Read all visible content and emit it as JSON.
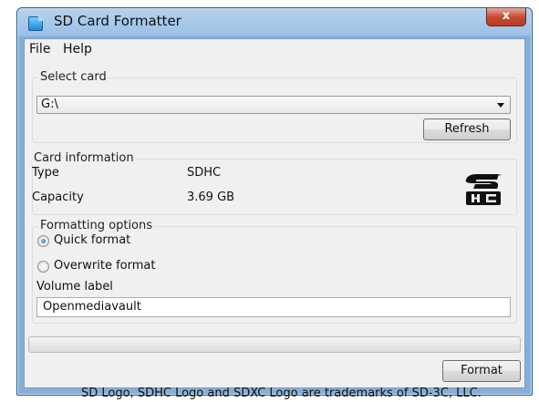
{
  "window": {
    "title": "SD Card Formatter",
    "close_glyph": "x"
  },
  "menu": {
    "file": "File",
    "help": "Help"
  },
  "select_card": {
    "group_label": "Select card",
    "selected_drive": "G:\\",
    "refresh_label": "Refresh"
  },
  "card_info": {
    "group_label": "Card information",
    "type_label": "Type",
    "type_value": "SDHC",
    "capacity_label": "Capacity",
    "capacity_value": "3.69 GB",
    "logo_icon": "sdhc-logo"
  },
  "formatting": {
    "group_label": "Formatting options",
    "quick_format": "Quick format",
    "quick_selected": true,
    "overwrite_format": "Overwrite format",
    "overwrite_selected": false,
    "volume_label_caption": "Volume label",
    "volume_label_value": "Openmediavault"
  },
  "progress": {
    "value": 0
  },
  "format_label": "Format",
  "footer": "SD Logo, SDHC Logo and SDXC Logo are trademarks of SD-3C, LLC."
}
